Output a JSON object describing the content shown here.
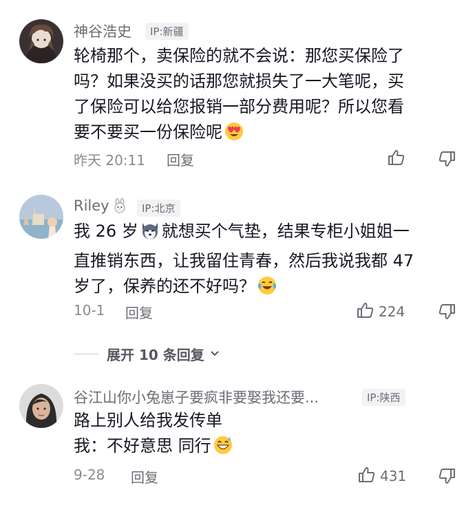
{
  "comments": [
    {
      "username": "神谷浩史",
      "ip": "IP:新疆",
      "lines": [
        "轮椅那个，卖保险的就不会说：那您买保险了",
        "吗？如果没买的话那您就损失了一大笔呢，买",
        "了保险可以给您报销一部分费用呢？所以您看",
        "要不要买一份保险呢"
      ],
      "time": "昨天 20:11",
      "reply_label": "回复",
      "like_count": "",
      "emoji": "heart-eyes-emoji"
    },
    {
      "username": "Riley",
      "ip": "IP:北京",
      "lines": [
        "我 26 岁",
        "就想买个气垫，结果专柜小姐姐一",
        "直推销东西，让我留住青春，然后我说我都 47",
        "岁了，保养的还不好吗？"
      ],
      "time": "10-1",
      "reply_label": "回复",
      "like_count": "224",
      "emoji": "crying-laughing-emoji"
    },
    {
      "username": "谷江山你小兔崽子要疯非要娶我还要...",
      "ip": "IP:陕西",
      "lines": [
        "路上别人给我发传单",
        "我：不好意思 同行"
      ],
      "time": "9-28",
      "reply_label": "回复",
      "like_count": "431",
      "emoji": "grinning-sweat-emoji"
    }
  ],
  "expand": {
    "label": "展开 10 条回复"
  },
  "colors": {
    "text": "#161823",
    "secondary": "#6b6d75",
    "meta": "#8a8b91",
    "badge_bg": "#f2f2f4"
  }
}
